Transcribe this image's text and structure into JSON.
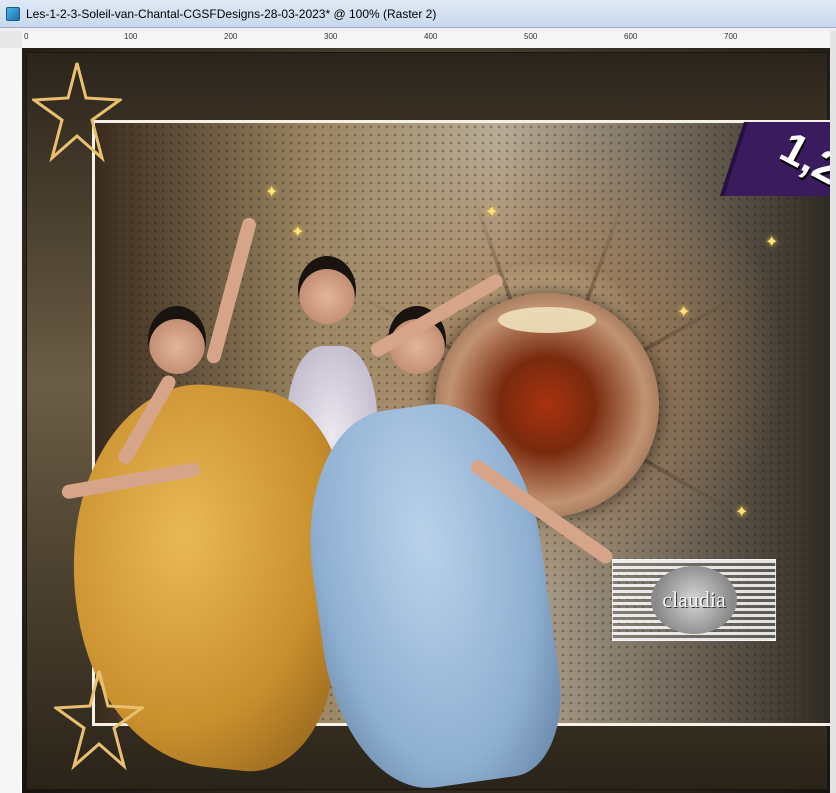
{
  "window": {
    "title": "Les-1-2-3-Soleil-van-Chantal-CGSFDesigns-28-03-2023* @ 100% (Raster 2)"
  },
  "ruler": {
    "ticks": [
      "0",
      "100",
      "200",
      "300",
      "400",
      "500",
      "600",
      "700"
    ]
  },
  "artwork": {
    "watermark_text": "claudia",
    "ribbon_text": "1,2"
  },
  "colors": {
    "titlebar": "#c9d8ec",
    "ribbon": "#3a1c5e",
    "star_outline": "#e8c070",
    "sphere_center": "#a8320f"
  },
  "icons": {
    "app": "psp-app-icon",
    "star": "star-outline-icon",
    "sparkle": "sparkle-icon"
  }
}
